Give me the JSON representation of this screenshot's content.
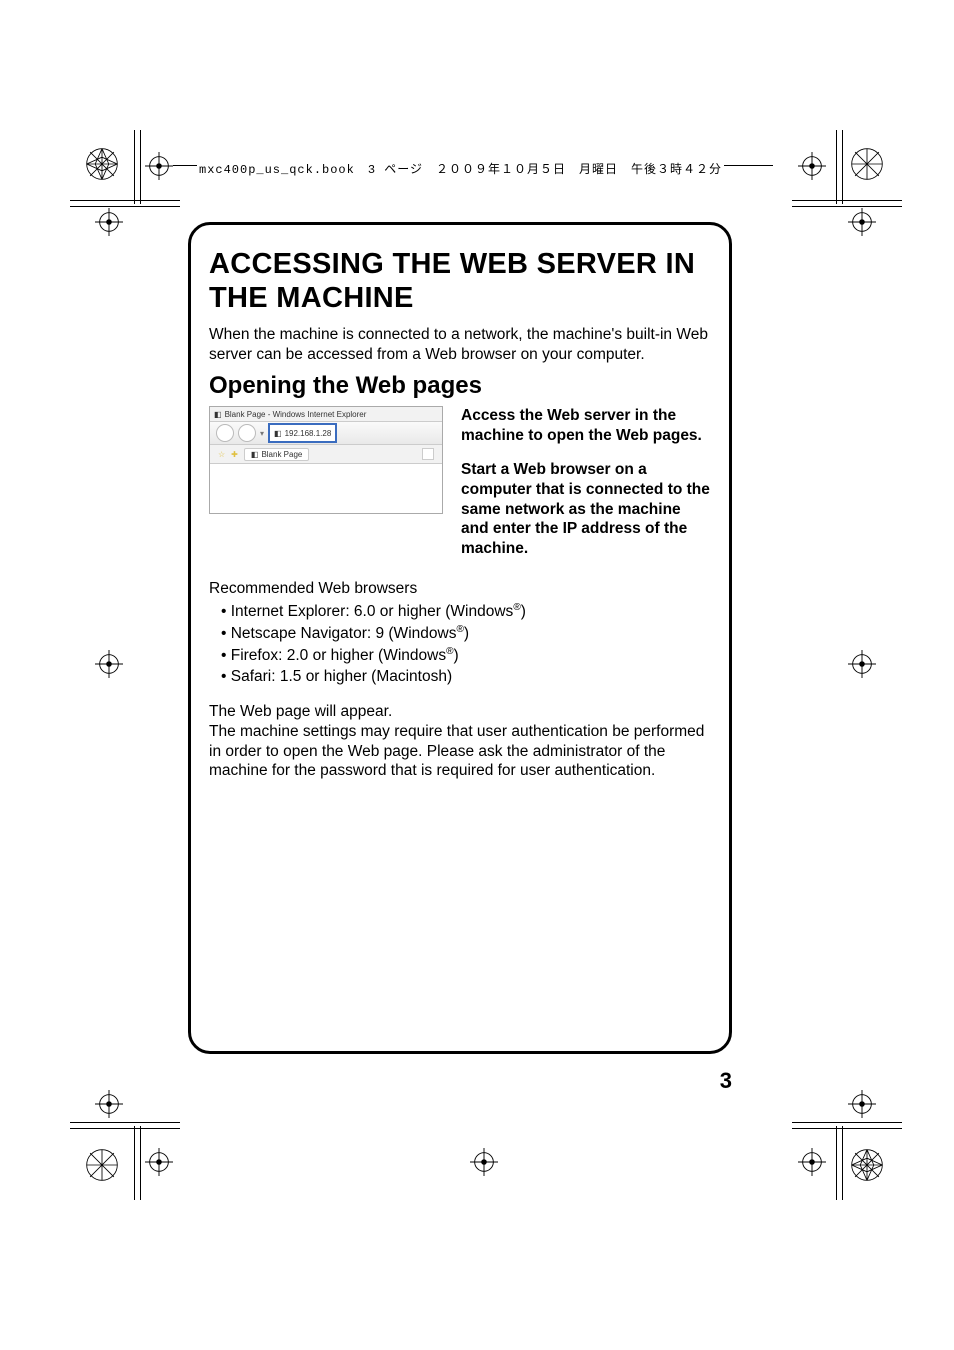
{
  "header_line": "mxc400p_us_qck.book　3 ページ　２００９年１０月５日　月曜日　午後３時４２分",
  "frame": {
    "title": "ACCESSING THE WEB SERVER IN THE MACHINE",
    "intro": "When the machine is connected to a network, the machine's built-in Web server can be accessed from a Web browser on your computer.",
    "h2": "Opening the Web pages",
    "screenshot": {
      "window_title": "Blank Page - Windows Internet Explorer",
      "address": "192.168.1.28",
      "tab_label": "Blank Page"
    },
    "right": {
      "p1": "Access the Web server in the machine to open the Web pages.",
      "p2": "Start a Web browser on a computer that is connected to the same network as the machine and enter the IP address of the machine."
    },
    "browsers_heading": "Recommended Web browsers",
    "browsers": [
      "Internet Explorer: 6.0 or higher (Windows®)",
      "Netscape Navigator: 9 (Windows®)",
      "Firefox: 2.0 or higher (Windows®)",
      "Safari: 1.5 or higher (Macintosh)"
    ],
    "after1": "The Web page will appear.",
    "after2": "The machine settings may require that user authentication be performed in order to open the Web page. Please ask the administrator of the machine for the password that is required for user authentication."
  },
  "page_number": "3"
}
